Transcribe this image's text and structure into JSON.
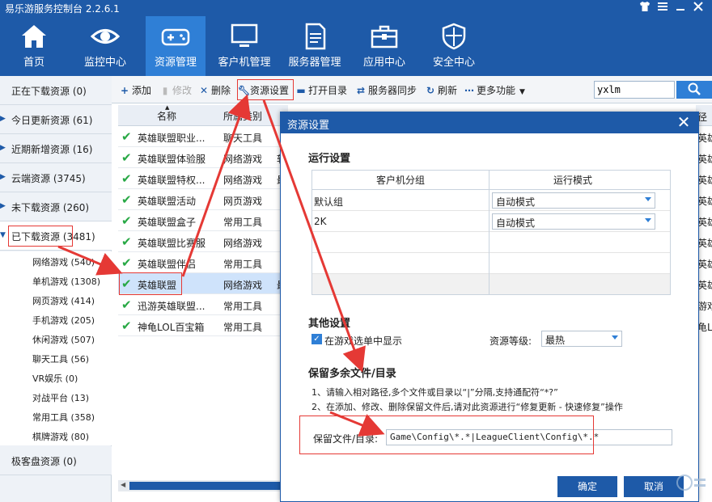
{
  "app": {
    "title": "易乐游服务控制台 2.2.6.1"
  },
  "window_controls": [
    "shirt-icon",
    "menu-icon",
    "minimize-icon",
    "close-icon"
  ],
  "nav": [
    {
      "label": "首页",
      "icon": "home-icon"
    },
    {
      "label": "监控中心",
      "icon": "eye-icon"
    },
    {
      "label": "资源管理",
      "icon": "gamepad-icon",
      "active": true
    },
    {
      "label": "客户机管理",
      "icon": "monitor-icon"
    },
    {
      "label": "服务器管理",
      "icon": "server-doc-icon"
    },
    {
      "label": "应用中心",
      "icon": "toolbox-icon"
    },
    {
      "label": "安全中心",
      "icon": "shield-icon"
    }
  ],
  "sidebar": {
    "items": [
      {
        "label": "正在下载资源 (0)"
      },
      {
        "label": "今日更新资源 (61)"
      },
      {
        "label": "近期新增资源 (16)"
      },
      {
        "label": "云端资源 (3745)"
      },
      {
        "label": "未下载资源 (260)"
      },
      {
        "label": "已下载资源 (3481)"
      }
    ],
    "subitems": [
      {
        "label": "网络游戏 (540)"
      },
      {
        "label": "单机游戏 (1308)"
      },
      {
        "label": "网页游戏 (414)"
      },
      {
        "label": "手机游戏 (205)"
      },
      {
        "label": "休闲游戏 (507)"
      },
      {
        "label": "聊天工具 (56)"
      },
      {
        "label": "VR娱乐 (0)"
      },
      {
        "label": "对战平台 (13)"
      },
      {
        "label": "常用工具 (358)"
      },
      {
        "label": "棋牌游戏 (80)"
      }
    ],
    "last": {
      "label": "极客盘资源 (0)"
    }
  },
  "toolbar": {
    "add": "添加",
    "edit": "修改",
    "delete": "删除",
    "resource_settings": "资源设置",
    "open_dir": "打开目录",
    "server_sync": "服务器同步",
    "refresh": "刷新",
    "more": "更多功能",
    "search_value": "yxlm"
  },
  "table": {
    "headers": {
      "name": "名称",
      "category": "所属类别"
    },
    "rows": [
      {
        "name": "英雄联盟职业...",
        "category": "聊天工具",
        "extra": ""
      },
      {
        "name": "英雄联盟体验服",
        "category": "网络游戏",
        "extra": "软"
      },
      {
        "name": "英雄联盟特权...",
        "category": "网络游戏",
        "extra": "最"
      },
      {
        "name": "英雄联盟活动",
        "category": "网页游戏",
        "extra": ""
      },
      {
        "name": "英雄联盟盒子",
        "category": "常用工具",
        "extra": ""
      },
      {
        "name": "英雄联盟比赛服",
        "category": "网络游戏",
        "extra": ""
      },
      {
        "name": "英雄联盟伴侣",
        "category": "常用工具",
        "extra": ""
      },
      {
        "name": "英雄联盟",
        "category": "网络游戏",
        "extra": "最",
        "selected": true
      },
      {
        "name": "迅游英雄联盟...",
        "category": "常用工具",
        "extra": ""
      },
      {
        "name": "神龟LOL百宝箱",
        "category": "常用工具",
        "extra": ""
      }
    ],
    "right_header": "径",
    "right_cells": [
      "英雄",
      "英雄",
      "英雄",
      "英雄",
      "英雄",
      "英雄",
      "英雄",
      "英雄",
      "游戏",
      "龟L"
    ]
  },
  "dialog": {
    "title": "资源设置",
    "run_settings": "运行设置",
    "grid_headers": {
      "group": "客户机分组",
      "mode": "运行模式"
    },
    "grid_rows": [
      {
        "group": "默认组",
        "mode": "自动模式"
      },
      {
        "group": "2K",
        "mode": "自动模式"
      }
    ],
    "other_settings": "其他设置",
    "show_in_menu": "在游戏选单中显示",
    "level_label": "资源等级:",
    "level_value": "最热",
    "keep_files_title": "保留多余文件/目录",
    "hint1": "1、请输入相对路径,多个文件或目录以“|”分隔,支持通配符“*?”",
    "hint2": "2、在添加、修改、删除保留文件后,请对此资源进行“修复更新 - 快速修复”操作",
    "keep_label": "保留文件/目录:",
    "keep_value": "Game\\Config\\*.*|LeagueClient\\Config\\*.*",
    "ok": "确定",
    "cancel": "取消"
  },
  "colors": {
    "brand": "#1e5aa8",
    "active_nav": "#2f7fd6",
    "annotation": "#e53935",
    "check": "#27a844"
  }
}
